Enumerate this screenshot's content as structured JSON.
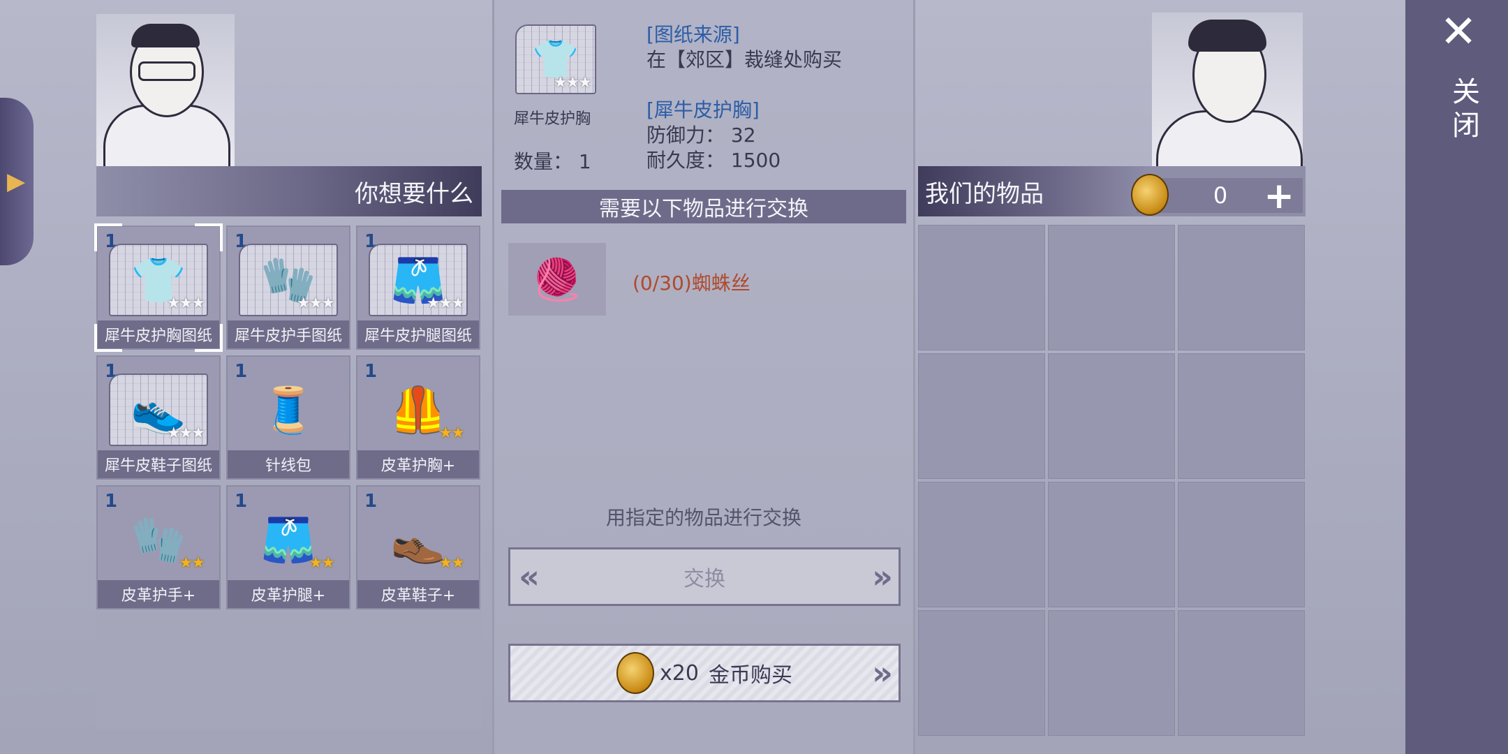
{
  "left": {
    "header": "你想要什么",
    "items": [
      {
        "qty": "1",
        "label": "犀牛皮护胸图纸",
        "type": "blueprint",
        "glyph": "👕",
        "stars": "★★★",
        "star_color": "silver",
        "selected": true
      },
      {
        "qty": "1",
        "label": "犀牛皮护手图纸",
        "type": "blueprint",
        "glyph": "🧤",
        "stars": "★★★",
        "star_color": "silver"
      },
      {
        "qty": "1",
        "label": "犀牛皮护腿图纸",
        "type": "blueprint",
        "glyph": "🩳",
        "stars": "★★★",
        "star_color": "silver"
      },
      {
        "qty": "1",
        "label": "犀牛皮鞋子图纸",
        "type": "blueprint",
        "glyph": "👟",
        "stars": "★★★",
        "star_color": "silver"
      },
      {
        "qty": "1",
        "label": "针线包",
        "type": "item",
        "glyph": "🧵",
        "stars": "",
        "star_color": "silver"
      },
      {
        "qty": "1",
        "label": "皮革护胸+",
        "type": "item",
        "glyph": "🦺",
        "stars": "★★",
        "star_color": "gold"
      },
      {
        "qty": "1",
        "label": "皮革护手+",
        "type": "item",
        "glyph": "🧤",
        "stars": "★★",
        "star_color": "gold"
      },
      {
        "qty": "1",
        "label": "皮革护腿+",
        "type": "item",
        "glyph": "🩳",
        "stars": "★★",
        "star_color": "gold"
      },
      {
        "qty": "1",
        "label": "皮革鞋子+",
        "type": "item",
        "glyph": "👞",
        "stars": "★★",
        "star_color": "gold"
      }
    ]
  },
  "detail": {
    "thumb_label": "犀牛皮护胸",
    "thumb_stars": "★★★",
    "quantity_label": "数量：",
    "quantity": "1",
    "source_title": "[图纸来源]",
    "source_text": "在【郊区】裁缝处购买",
    "product_title": "[犀牛皮护胸]",
    "defense_label": "防御力：",
    "defense": "32",
    "durability_label": "耐久度：",
    "durability": "1500",
    "need_header": "需要以下物品进行交换",
    "requirement": "(0/30)蜘蛛丝",
    "hint": "用指定的物品进行交换",
    "exchange_label": "交换",
    "buy_amount": "x20",
    "buy_label": "金币购买"
  },
  "right": {
    "header": "我们的物品",
    "coins": "0",
    "inventory_slots": 12
  },
  "close": {
    "label": "关闭"
  }
}
